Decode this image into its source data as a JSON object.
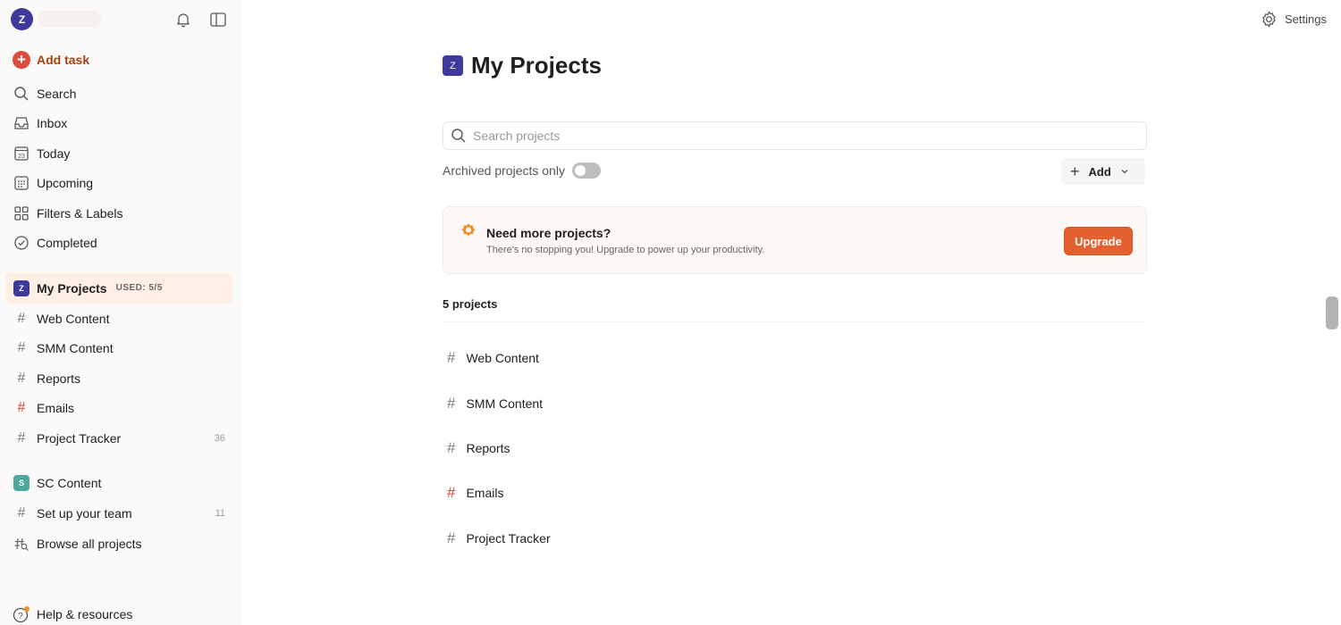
{
  "user": {
    "initial": "Z"
  },
  "sidebar": {
    "add_task": "Add task",
    "nav": [
      {
        "label": "Search",
        "icon": "search-icon"
      },
      {
        "label": "Inbox",
        "icon": "inbox-icon"
      },
      {
        "label": "Today",
        "icon": "calendar-today-icon",
        "day": "23"
      },
      {
        "label": "Upcoming",
        "icon": "calendar-upcoming-icon"
      },
      {
        "label": "Filters & Labels",
        "icon": "filters-grid-icon"
      },
      {
        "label": "Completed",
        "icon": "check-circle-icon"
      }
    ],
    "my_projects": {
      "initial": "Z",
      "label": "My Projects",
      "used": "USED: 5/5"
    },
    "projects": [
      {
        "label": "Web Content",
        "count": ""
      },
      {
        "label": "SMM Content",
        "count": ""
      },
      {
        "label": "Reports",
        "count": ""
      },
      {
        "label": "Emails",
        "count": "",
        "color": "#d1453b"
      },
      {
        "label": "Project Tracker",
        "count": "36"
      }
    ],
    "team": {
      "initial": "S",
      "label": "SC Content",
      "color": "#4ba89b"
    },
    "team_items": [
      {
        "label": "Set up your team",
        "count": "11"
      },
      {
        "label": "Browse all projects",
        "count": ""
      }
    ],
    "help": "Help & resources"
  },
  "header": {
    "settings": "Settings"
  },
  "main": {
    "title_initial": "Z",
    "title": "My Projects",
    "search_placeholder": "Search projects",
    "archived_label": "Archived projects only",
    "add_label": "Add",
    "upgrade": {
      "title": "Need more projects?",
      "subtitle": "There's no stopping you! Upgrade to power up your productivity.",
      "button": "Upgrade"
    },
    "count_label": "5 projects",
    "projects": [
      {
        "label": "Web Content"
      },
      {
        "label": "SMM Content"
      },
      {
        "label": "Reports"
      },
      {
        "label": "Emails",
        "color": "#d1453b"
      },
      {
        "label": "Project Tracker"
      }
    ]
  },
  "colors": {
    "accent": "#dc4c3e",
    "brand_purple": "#3e3a9c",
    "upgrade_orange": "#e4602e"
  }
}
